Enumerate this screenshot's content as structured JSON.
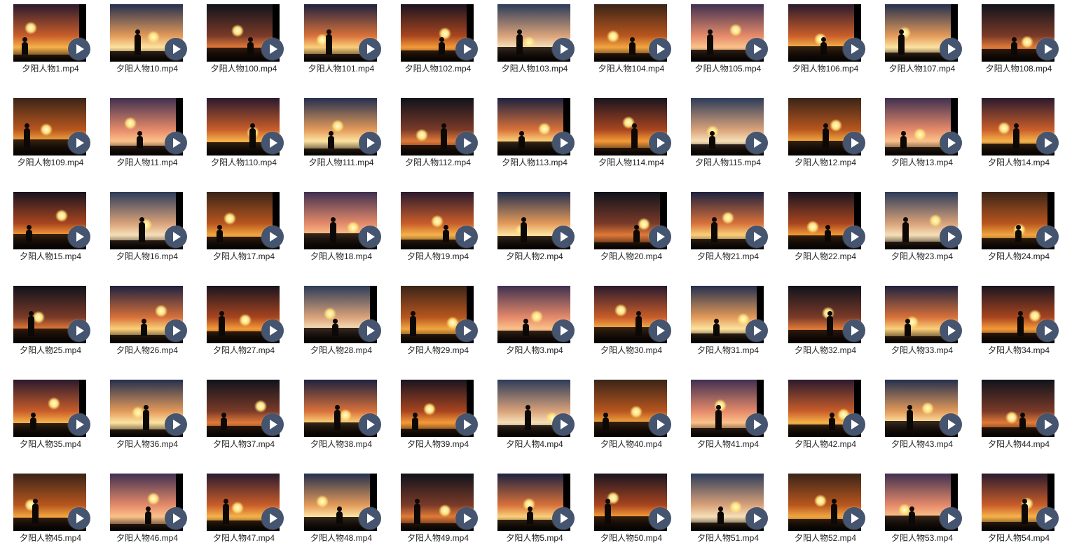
{
  "window": {
    "view": "thumbnails"
  },
  "colors": {
    "play_button": "#45546f",
    "label_text": "#222222",
    "background": "#ffffff"
  },
  "icons": {
    "play": "play-icon"
  },
  "files": [
    {
      "name": "夕阳人物1.mp4"
    },
    {
      "name": "夕阳人物10.mp4"
    },
    {
      "name": "夕阳人物100.mp4"
    },
    {
      "name": "夕阳人物101.mp4"
    },
    {
      "name": "夕阳人物102.mp4"
    },
    {
      "name": "夕阳人物103.mp4"
    },
    {
      "name": "夕阳人物104.mp4"
    },
    {
      "name": "夕阳人物105.mp4"
    },
    {
      "name": "夕阳人物106.mp4"
    },
    {
      "name": "夕阳人物107.mp4"
    },
    {
      "name": "夕阳人物108.mp4"
    },
    {
      "name": "夕阳人物109.mp4"
    },
    {
      "name": "夕阳人物11.mp4"
    },
    {
      "name": "夕阳人物110.mp4"
    },
    {
      "name": "夕阳人物111.mp4"
    },
    {
      "name": "夕阳人物112.mp4"
    },
    {
      "name": "夕阳人物113.mp4"
    },
    {
      "name": "夕阳人物114.mp4"
    },
    {
      "name": "夕阳人物115.mp4"
    },
    {
      "name": "夕阳人物12.mp4"
    },
    {
      "name": "夕阳人物13.mp4"
    },
    {
      "name": "夕阳人物14.mp4"
    },
    {
      "name": "夕阳人物15.mp4"
    },
    {
      "name": "夕阳人物16.mp4"
    },
    {
      "name": "夕阳人物17.mp4"
    },
    {
      "name": "夕阳人物18.mp4"
    },
    {
      "name": "夕阳人物19.mp4"
    },
    {
      "name": "夕阳人物2.mp4"
    },
    {
      "name": "夕阳人物20.mp4"
    },
    {
      "name": "夕阳人物21.mp4"
    },
    {
      "name": "夕阳人物22.mp4"
    },
    {
      "name": "夕阳人物23.mp4"
    },
    {
      "name": "夕阳人物24.mp4"
    },
    {
      "name": "夕阳人物25.mp4"
    },
    {
      "name": "夕阳人物26.mp4"
    },
    {
      "name": "夕阳人物27.mp4"
    },
    {
      "name": "夕阳人物28.mp4"
    },
    {
      "name": "夕阳人物29.mp4"
    },
    {
      "name": "夕阳人物3.mp4"
    },
    {
      "name": "夕阳人物30.mp4"
    },
    {
      "name": "夕阳人物31.mp4"
    },
    {
      "name": "夕阳人物32.mp4"
    },
    {
      "name": "夕阳人物33.mp4"
    },
    {
      "name": "夕阳人物34.mp4"
    },
    {
      "name": "夕阳人物35.mp4"
    },
    {
      "name": "夕阳人物36.mp4"
    },
    {
      "name": "夕阳人物37.mp4"
    },
    {
      "name": "夕阳人物38.mp4"
    },
    {
      "name": "夕阳人物39.mp4"
    },
    {
      "name": "夕阳人物4.mp4"
    },
    {
      "name": "夕阳人物40.mp4"
    },
    {
      "name": "夕阳人物41.mp4"
    },
    {
      "name": "夕阳人物42.mp4"
    },
    {
      "name": "夕阳人物43.mp4"
    },
    {
      "name": "夕阳人物44.mp4"
    },
    {
      "name": "夕阳人物45.mp4"
    },
    {
      "name": "夕阳人物46.mp4"
    },
    {
      "name": "夕阳人物47.mp4"
    },
    {
      "name": "夕阳人物48.mp4"
    },
    {
      "name": "夕阳人物49.mp4"
    },
    {
      "name": "夕阳人物5.mp4"
    },
    {
      "name": "夕阳人物50.mp4"
    },
    {
      "name": "夕阳人物51.mp4"
    },
    {
      "name": "夕阳人物52.mp4"
    },
    {
      "name": "夕阳人物53.mp4"
    },
    {
      "name": "夕阳人物54.mp4"
    }
  ]
}
